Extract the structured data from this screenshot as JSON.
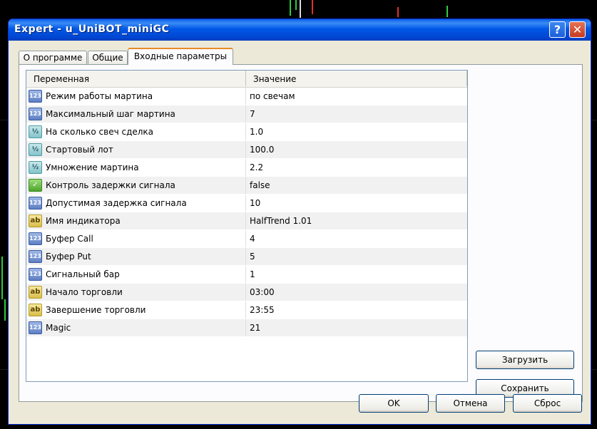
{
  "window": {
    "title": "Expert - u_UniBOT_miniGC"
  },
  "titlebar": {
    "help_symbol": "?",
    "close_symbol": "✕"
  },
  "tabs": [
    {
      "label": "О программе"
    },
    {
      "label": "Общие"
    },
    {
      "label": "Входные параметры"
    }
  ],
  "table": {
    "headers": {
      "variable": "Переменная",
      "value": "Значение"
    },
    "rows": [
      {
        "type": "int",
        "icon": "123",
        "name": "Режим работы мартина",
        "value": "по свечам"
      },
      {
        "type": "int",
        "icon": "123",
        "name": "Максимальный шаг мартина",
        "value": "7"
      },
      {
        "type": "double",
        "icon": "½",
        "name": "На сколько свеч сделка",
        "value": "1.0"
      },
      {
        "type": "double",
        "icon": "½",
        "name": "Стартовый лот",
        "value": "100.0"
      },
      {
        "type": "double",
        "icon": "½",
        "name": "Умножение мартина",
        "value": "2.2"
      },
      {
        "type": "bool",
        "icon": "✓",
        "name": "Контроль задержки сигнала",
        "value": "false"
      },
      {
        "type": "int",
        "icon": "123",
        "name": "Допустимая задержка сигнала",
        "value": "10"
      },
      {
        "type": "string",
        "icon": "ab",
        "name": "Имя индикатора",
        "value": "HalfTrend 1.01"
      },
      {
        "type": "int",
        "icon": "123",
        "name": "Буфер Call",
        "value": "4"
      },
      {
        "type": "int",
        "icon": "123",
        "name": "Буфер Put",
        "value": "5"
      },
      {
        "type": "int",
        "icon": "123",
        "name": "Сигнальный бар",
        "value": "1"
      },
      {
        "type": "string",
        "icon": "ab",
        "name": "Начало торговли",
        "value": "03:00"
      },
      {
        "type": "string",
        "icon": "ab",
        "name": "Завершение торговли",
        "value": "23:55"
      },
      {
        "type": "int",
        "icon": "123",
        "name": "Magic",
        "value": "21"
      }
    ]
  },
  "side_buttons": {
    "load": "Загрузить",
    "save": "Сохранить"
  },
  "footer_buttons": {
    "ok": "OK",
    "cancel": "Отмена",
    "reset": "Сброс"
  },
  "colors": {
    "title_bar": "#0058e6",
    "dialog_bg": "#ece9d8",
    "tab_highlight": "#e68b2c"
  }
}
